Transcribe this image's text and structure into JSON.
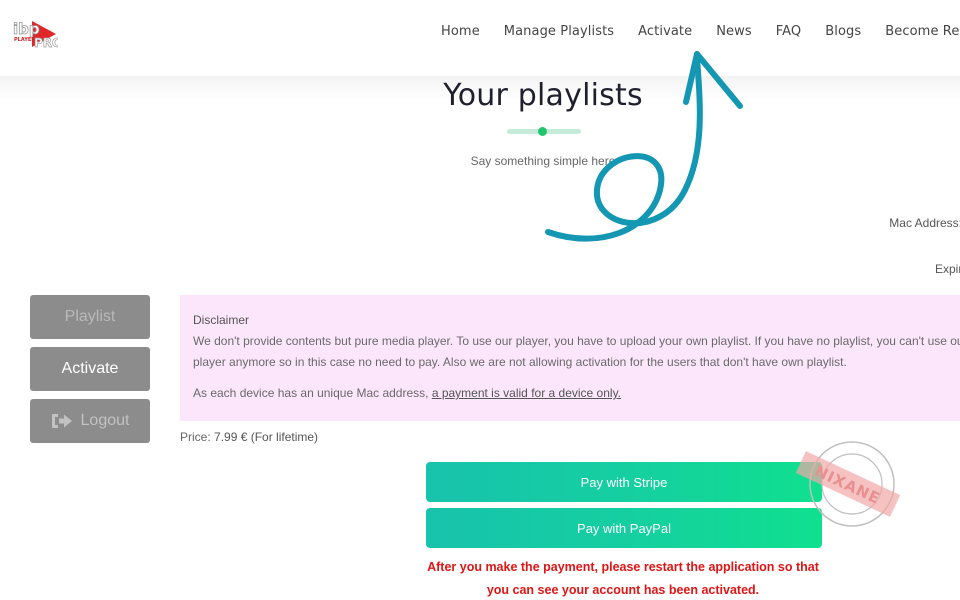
{
  "header": {
    "logo_text": "ibp PLAYER PRO",
    "nav": [
      "Home",
      "Manage Playlists",
      "Activate",
      "News",
      "FAQ",
      "Blogs",
      "Become Reseller"
    ]
  },
  "page": {
    "title": "Your playlists",
    "subtitle": "Say something simple here",
    "mac_address_label": "Mac Address:",
    "expiry_label": "Expiry:"
  },
  "sidebar": {
    "items": [
      {
        "label": "Playlist",
        "icon": null
      },
      {
        "label": "Activate",
        "icon": null
      },
      {
        "label": "Logout",
        "icon": "sign-out-icon"
      }
    ]
  },
  "disclaimer": {
    "heading": "Disclaimer",
    "line1": "We don't provide contents but pure media player. To use our player, you have to upload your own playlist. If you have no playlist, you can't use our",
    "line2": "player anymore so in this case no need to pay. Also we are not allowing activation for the users that don't have own playlist.",
    "note_prefix": "As each device has an unique Mac address, ",
    "note_link": "a payment is valid for a device only."
  },
  "pricing": {
    "label": "Price: ",
    "value": "7.99 € (For lifetime)"
  },
  "payment": {
    "stripe_label": "Pay with Stripe",
    "paypal_label": "Pay with PayPal",
    "notice_line1": "After you make the payment, please restart the application so that",
    "notice_line2": "you can see your account has been activated."
  },
  "watermark": {
    "text": "NIXANE"
  },
  "colors": {
    "accent_green": "#15d09f",
    "notice_red": "#e01515",
    "disclaimer_bg": "#fce6fb",
    "annotation_teal": "#1497b3"
  }
}
